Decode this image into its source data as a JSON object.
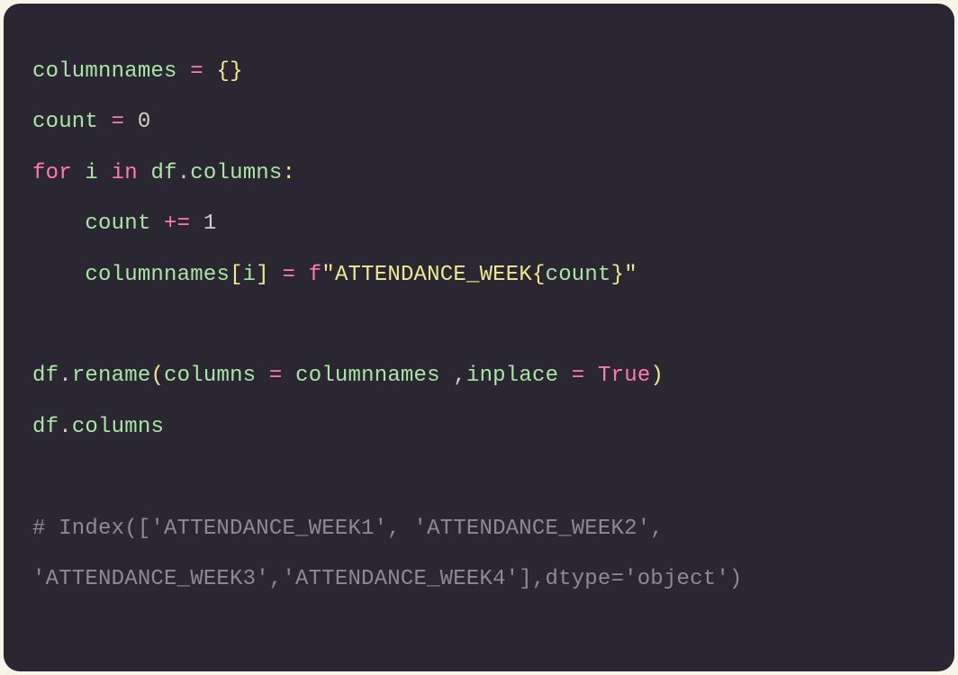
{
  "code": {
    "line1": {
      "var": "columnnames",
      "op": "=",
      "braces_open": "{",
      "braces_close": "}"
    },
    "line2": {
      "var": "count",
      "op": "=",
      "num": "0"
    },
    "line3": {
      "for": "for",
      "i": "i",
      "in": "in",
      "df": "df",
      "dot": ".",
      "columns": "columns",
      "colon": ":"
    },
    "line4": {
      "indent": "    ",
      "var": "count",
      "op": "+=",
      "num": "1"
    },
    "line5": {
      "indent": "    ",
      "var": "columnnames",
      "lbrack": "[",
      "i": "i",
      "rbrack": "]",
      "eq": "=",
      "f": "f",
      "q1": "\"",
      "str1": "ATTENDANCE_WEEK",
      "lcurly": "{",
      "count": "count",
      "rcurly": "}",
      "q2": "\""
    },
    "line6": {
      "df": "df",
      "dot1": ".",
      "rename": "rename",
      "lparen": "(",
      "columns_kw": "columns",
      "eq1": "=",
      "columnnames": "columnnames",
      "comma": ",",
      "inplace": "inplace",
      "eq2": "=",
      "true": "True",
      "rparen": ")"
    },
    "line7": {
      "df": "df",
      "dot": ".",
      "columns": "columns"
    },
    "comment1": "# Index(['ATTENDANCE_WEEK1', 'ATTENDANCE_WEEK2',",
    "comment2": "'ATTENDANCE_WEEK3','ATTENDANCE_WEEK4'],dtype='object')"
  }
}
